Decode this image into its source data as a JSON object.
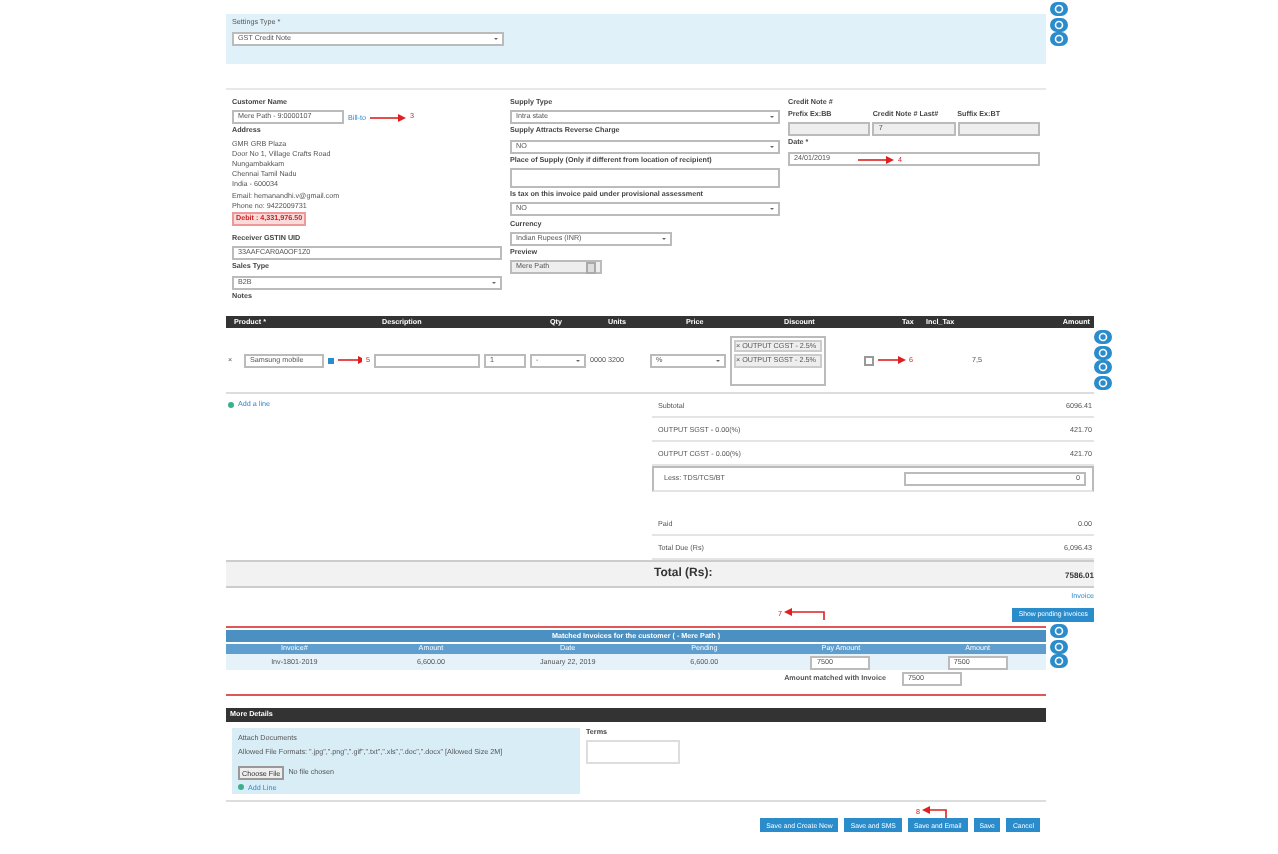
{
  "settings": {
    "label": "Settings Type *",
    "value": "GST Credit Note"
  },
  "customer": {
    "label": "Customer Name",
    "value": "Mere Path - 9:0000107",
    "link": "Bill-to",
    "annotation": "3",
    "address_label": "Address",
    "address_lines": [
      "GMR GRB Plaza",
      "Door No 1, Village Crafts Road",
      "Nungambakkam",
      "Chennai Tamil Nadu",
      "India - 600034",
      "Email: hemanandhi.v@gmail.com",
      "Phone no: 9422009731"
    ],
    "debit": "Debit : 4,331,976.50",
    "gstin_label": "Receiver GSTIN UID",
    "gstin": "33AAFCAR0A0OF1Z0",
    "sales_type_label": "Sales Type",
    "sales_type": "B2B",
    "notes_label": "Notes"
  },
  "supply_fields": [
    {
      "label": "Supply Type",
      "value": "Intra state",
      "kind": "select"
    },
    {
      "label": "Supply Attracts Reverse Charge",
      "value": "NO",
      "kind": "select"
    },
    {
      "label": "Place of Supply (Only if different from location of recipient)",
      "kind": "text"
    },
    {
      "label": "Is tax on this invoice paid under provisional assessment",
      "value": "NO",
      "kind": "select"
    },
    {
      "label": "Currency",
      "value": "Indian Rupees (INR)",
      "kind": "short-select"
    },
    {
      "label": "Preview",
      "value": "Mere Path",
      "kind": "spinner"
    }
  ],
  "credit_note": {
    "label": "Credit Note #",
    "columns": [
      {
        "label": "Prefix Ex:BB"
      },
      {
        "label": "Credit Note # Last#",
        "value": "7"
      },
      {
        "label": "Suffix Ex:BT"
      }
    ],
    "date_label": "Date *",
    "date": "24/01/2019",
    "annotation": "4"
  },
  "items": {
    "columns": [
      "Product *",
      "Description",
      "Qty",
      "Units",
      "Price",
      "Discount",
      "Tax",
      "Incl_Tax",
      "Amount"
    ],
    "row": {
      "bullet": "×",
      "product": "Samsung mobile",
      "product_annotation": "5",
      "qty": "1",
      "unit": "-",
      "hsn": "0000 3200",
      "price_unit": "%",
      "taxes": [
        "× OUTPUT CGST - 2.5%",
        "× OUTPUT SGST - 2.5%"
      ],
      "tax_checked": false,
      "tax_annotation": "6",
      "amount": "7,5"
    }
  },
  "add_line": "Add a line",
  "totals": [
    {
      "label": "Subtotal",
      "value": "6096.41",
      "kind": "text"
    },
    {
      "label": "OUTPUT SGST - 0.00(%)",
      "value": "421.70",
      "kind": "text"
    },
    {
      "label": "OUTPUT CGST - 0.00(%)",
      "value": "421.70",
      "kind": "text"
    },
    {
      "label": "Less: TDS/TCS/BT",
      "value": "0",
      "kind": "input"
    },
    {
      "label": "Paid",
      "value": "0.00",
      "kind": "text"
    },
    {
      "label": "Total Due (Rs)",
      "value": "6,096.43",
      "kind": "text"
    }
  ],
  "total": {
    "label": "Total (Rs):",
    "value": "7586.01"
  },
  "invoice_link": "Invoice",
  "pending_annotation": "7",
  "pending_button": "Show pending invoices",
  "matched": {
    "title": "Matched Invoices for the customer ( - Mere Path )",
    "columns": [
      "Invoice#",
      "Amount",
      "Date",
      "Pending",
      "Pay Amount",
      "Amount"
    ],
    "row": [
      "Inv-1801-2019",
      "6,600.00",
      "January 22, 2019",
      "6,600.00",
      "7500",
      "7500"
    ],
    "footer_label": "Amount matched with Invoice",
    "footer_value": "7500"
  },
  "more": {
    "title": "More Details",
    "attach_title": "Attach Documents",
    "allowed": "Allowed File Formats: \".jpg\",\".png\",\".gif\",\".txt\",\".xls\",\".doc\",\".docx\" [Allowed Size 2M]",
    "choose": "Choose File",
    "no_file": "No file chosen",
    "add": "Add Line",
    "terms_label": "Terms"
  },
  "save_annotation": "8",
  "buttons": [
    "Save and Create New",
    "Save and SMS",
    "Save and Email",
    "Save",
    "Cancel"
  ]
}
